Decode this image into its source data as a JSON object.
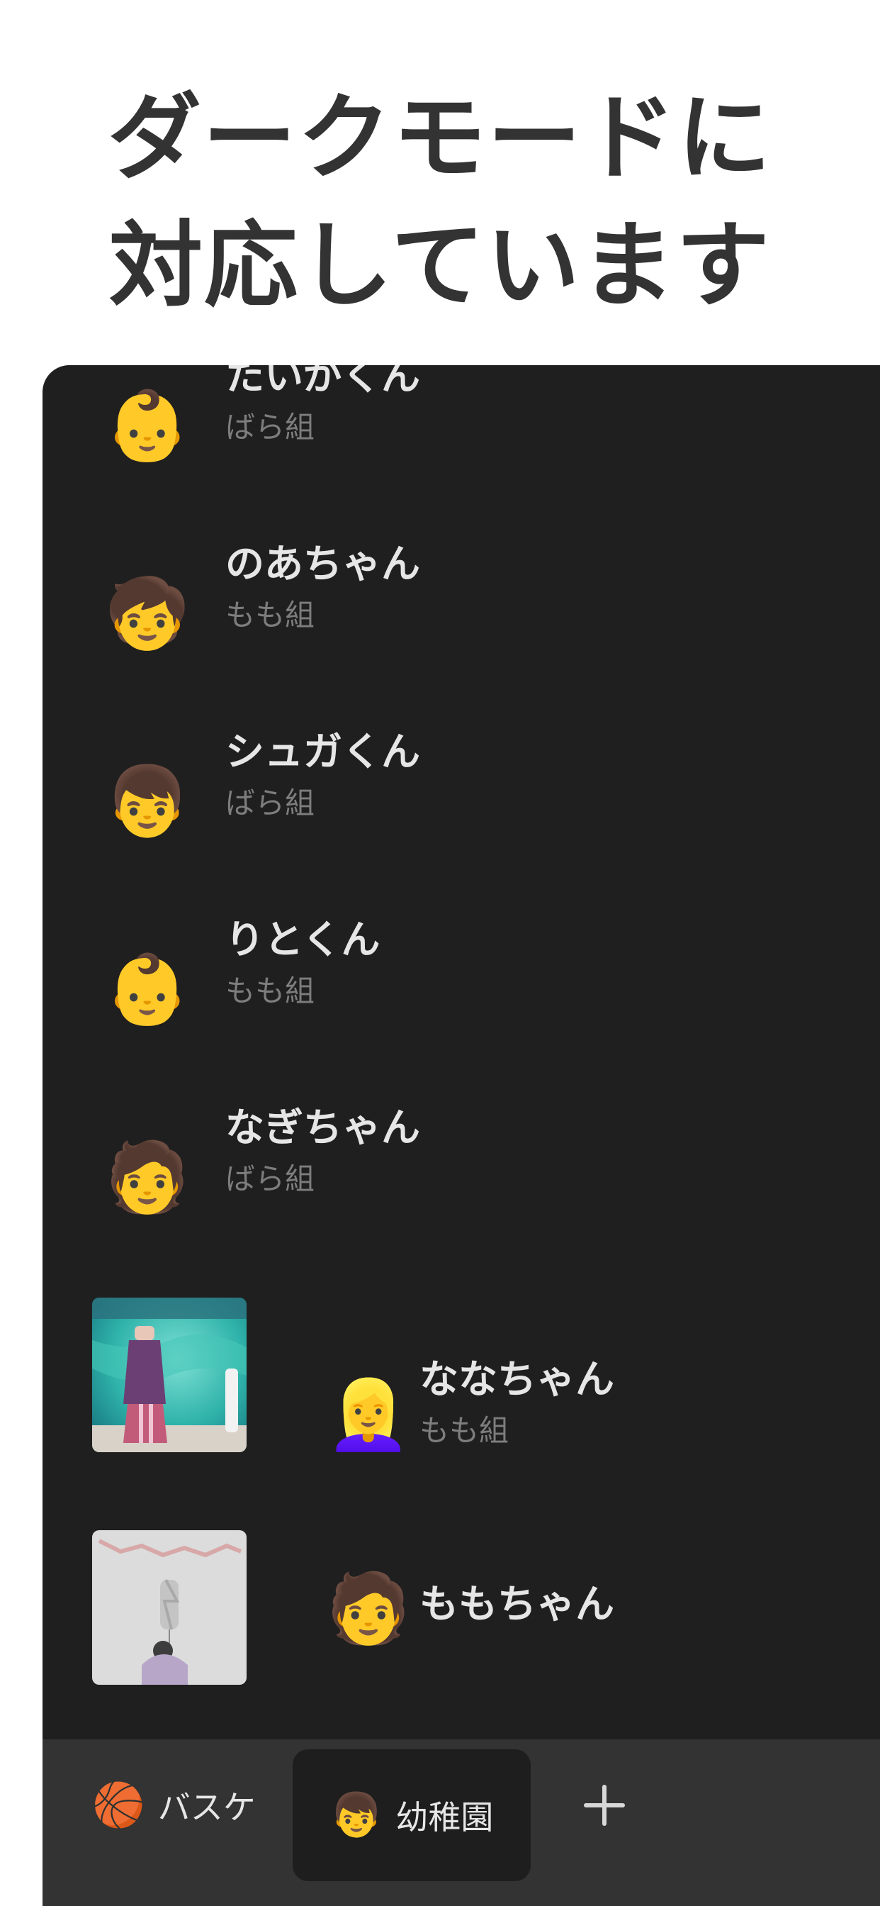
{
  "headline": {
    "line1": "ダークモードに",
    "line2": "対応しています"
  },
  "children": [
    {
      "icon": "👶",
      "icon_name": "baby-face-icon",
      "name": "たいがくん",
      "group": "ばら組"
    },
    {
      "icon": "🧒",
      "icon_name": "child-face-icon",
      "name": "のあちゃん",
      "group": "もも組"
    },
    {
      "icon": "👦",
      "icon_name": "boy-face-icon",
      "name": "シュガくん",
      "group": "ばら組"
    },
    {
      "icon": "👶",
      "icon_name": "baby-face-icon",
      "name": "りとくん",
      "group": "もも組"
    },
    {
      "icon": "🧑",
      "icon_name": "red-hair-child-icon",
      "name": "なぎちゃん",
      "group": "ばら組"
    },
    {
      "icon": "👱‍♀️",
      "icon_name": "woman-blond-icon",
      "name": "ななちゃん",
      "group": "もも組",
      "photo": "stage-photo"
    },
    {
      "icon": "🧑",
      "icon_name": "red-hair-child-icon",
      "name": "ももちゃん",
      "group": "",
      "photo": "birthday-photo"
    }
  ],
  "tabs": [
    {
      "icon": "🏀",
      "icon_name": "basketball-icon",
      "label": "バスケ",
      "active": false
    },
    {
      "icon": "👦",
      "icon_name": "boy-face-icon",
      "label": "幼稚園",
      "active": true
    }
  ],
  "add_tab_icon": "plus-icon",
  "colors": {
    "background": "#ffffff",
    "panel": "#1f1f1f",
    "tabbar": "#333333",
    "name_text": "#e6e6e6",
    "group_text": "#7d7d7d",
    "headline_text": "#333333"
  }
}
